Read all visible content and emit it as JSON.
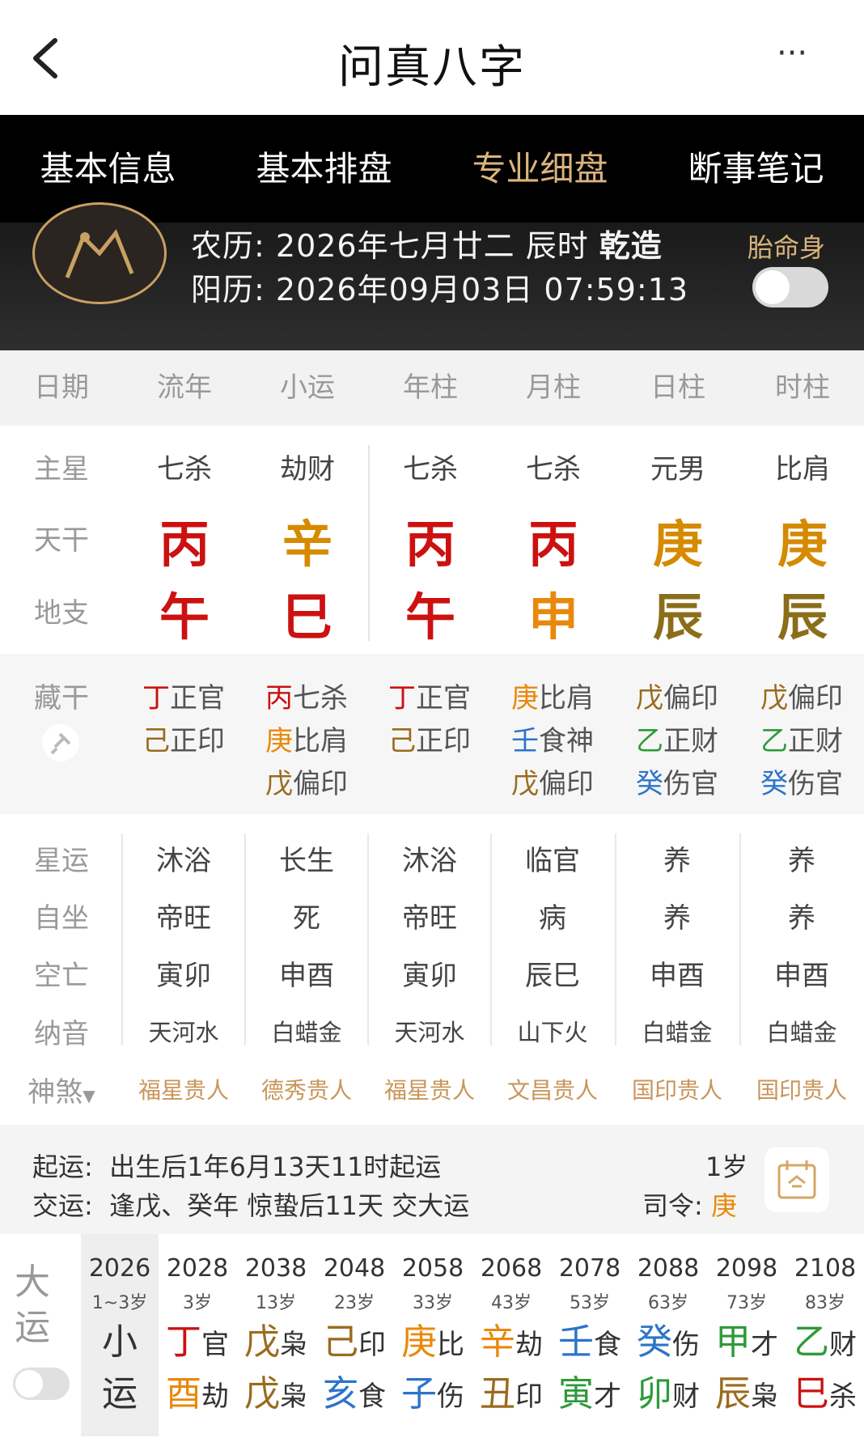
{
  "header": {
    "title": "问真八字",
    "back_icon": "chevron-left-icon",
    "more_icon": "more-icon",
    "more_glyph": "···"
  },
  "tabs": [
    {
      "label": "基本信息"
    },
    {
      "label": "基本排盘"
    },
    {
      "label": "专业细盘",
      "active": true
    },
    {
      "label": "断事笔记"
    }
  ],
  "info": {
    "lunar_label": "农历:",
    "lunar_value": "2026年七月廿二 辰时",
    "gender": "乾造",
    "solar_label": "阳历:",
    "solar_value": "2026年09月03日 07:59:13",
    "taiming": "胎命身"
  },
  "columns": [
    "日期",
    "流年",
    "小运",
    "年柱",
    "月柱",
    "日柱",
    "时柱"
  ],
  "row_labels": {
    "zhuxing": "主星",
    "tiangan": "天干",
    "dizhi": "地支",
    "canggan": "藏干",
    "xingyun": "星运",
    "zizuo": "自坐",
    "kongwang": "空亡",
    "nayin": "纳音",
    "shensha": "神煞"
  },
  "zhuxing": [
    "七杀",
    "劫财",
    "七杀",
    "七杀",
    "元男",
    "比肩"
  ],
  "tiangan": [
    "丙",
    "辛",
    "丙",
    "丙",
    "庚",
    "庚"
  ],
  "dizhi": [
    "午",
    "巳",
    "午",
    "申",
    "辰",
    "辰"
  ],
  "canggan": [
    [
      [
        "丁",
        "正官"
      ],
      [
        "己",
        "正印"
      ]
    ],
    [
      [
        "丙",
        "七杀"
      ],
      [
        "庚",
        "比肩"
      ],
      [
        "戊",
        "偏印"
      ]
    ],
    [
      [
        "丁",
        "正官"
      ],
      [
        "己",
        "正印"
      ]
    ],
    [
      [
        "庚",
        "比肩"
      ],
      [
        "壬",
        "食神"
      ],
      [
        "戊",
        "偏印"
      ]
    ],
    [
      [
        "戊",
        "偏印"
      ],
      [
        "乙",
        "正财"
      ],
      [
        "癸",
        "伤官"
      ]
    ],
    [
      [
        "戊",
        "偏印"
      ],
      [
        "乙",
        "正财"
      ],
      [
        "癸",
        "伤官"
      ]
    ]
  ],
  "xingyun": [
    "沐浴",
    "长生",
    "沐浴",
    "临官",
    "养",
    "养"
  ],
  "zizuo": [
    "帝旺",
    "死",
    "帝旺",
    "病",
    "养",
    "养"
  ],
  "kongwang": [
    "寅卯",
    "申酉",
    "寅卯",
    "辰巳",
    "申酉",
    "申酉"
  ],
  "nayin": [
    "天河水",
    "白蜡金",
    "天河水",
    "山下火",
    "白蜡金",
    "白蜡金"
  ],
  "shensha": [
    "福星贵人",
    "德秀贵人",
    "福星贵人",
    "文昌贵人",
    "国印贵人",
    "国印贵人"
  ],
  "qiyun": {
    "qiyun_label": "起运:",
    "qiyun_value": "出生后1年6月13天11时起运",
    "jiaoyun_label": "交运:",
    "jiaoyun_value": "逢戊、癸年 惊蛰后11天 交大运",
    "age": "1岁",
    "siling_label": "司令:",
    "siling_value": "庚"
  },
  "dayun": {
    "label1": "大",
    "label2": "运",
    "current": {
      "year": "2026",
      "age": "1~3岁",
      "c1": "小",
      "c2": "运"
    },
    "items": [
      {
        "year": "2028",
        "age": "3岁",
        "g": "丁",
        "gs": "官",
        "z": "酉",
        "zs": "劫"
      },
      {
        "year": "2038",
        "age": "13岁",
        "g": "戊",
        "gs": "枭",
        "z": "戊",
        "zs": "枭"
      },
      {
        "year": "2048",
        "age": "23岁",
        "g": "己",
        "gs": "印",
        "z": "亥",
        "zs": "食"
      },
      {
        "year": "2058",
        "age": "33岁",
        "g": "庚",
        "gs": "比",
        "z": "子",
        "zs": "伤"
      },
      {
        "year": "2068",
        "age": "43岁",
        "g": "辛",
        "gs": "劫",
        "z": "丑",
        "zs": "印"
      },
      {
        "year": "2078",
        "age": "53岁",
        "g": "壬",
        "gs": "食",
        "z": "寅",
        "zs": "才"
      },
      {
        "year": "2088",
        "age": "63岁",
        "g": "癸",
        "gs": "伤",
        "z": "卯",
        "zs": "财"
      },
      {
        "year": "2098",
        "age": "73岁",
        "g": "甲",
        "gs": "才",
        "z": "辰",
        "zs": "枭"
      },
      {
        "year": "2108",
        "age": "83岁",
        "g": "乙",
        "gs": "财",
        "z": "巳",
        "zs": "杀"
      }
    ]
  }
}
